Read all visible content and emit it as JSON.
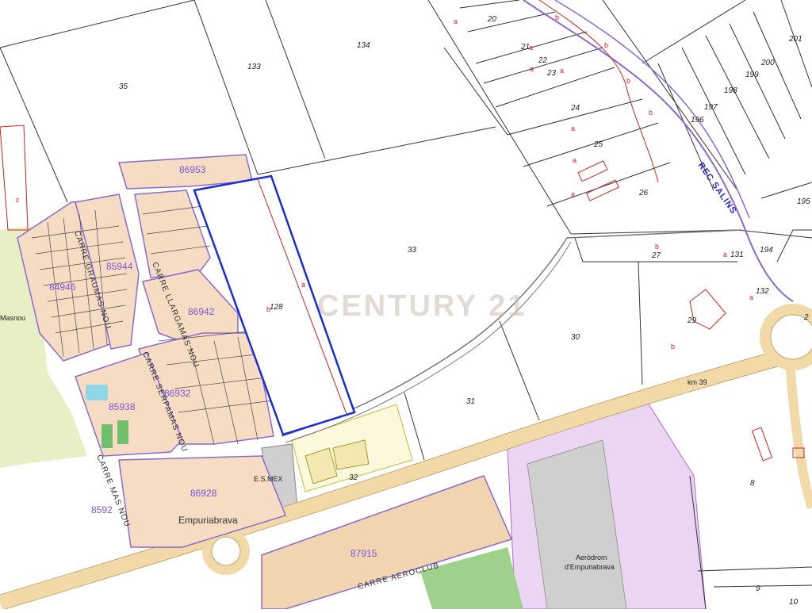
{
  "watermark": "CENTURY 21",
  "plots": {
    "p35": "35",
    "p133": "133",
    "p134": "134",
    "p128": "128",
    "p33": "33",
    "p20": "20",
    "p21": "21",
    "p22": "22",
    "p23": "23",
    "p24": "24",
    "p25": "25",
    "p26": "26",
    "p27": "27",
    "p29": "29",
    "p30": "30",
    "p31": "31",
    "p32": "32",
    "p8": "8",
    "p9": "9",
    "p10": "10",
    "p131": "131",
    "p132": "132",
    "p194": "194",
    "p195": "195",
    "p196": "196",
    "p197": "197",
    "p198": "198",
    "p199": "199",
    "p200": "200",
    "p201": "201",
    "p2": "2"
  },
  "registry": {
    "r86953": "86953",
    "r85944": "85944",
    "r84946": "84946",
    "r86942": "86942",
    "r86932": "86932",
    "r85938": "85938",
    "r86928": "86928",
    "r8592": "8592",
    "r87915": "87915"
  },
  "streets": {
    "carre_graumas_nou": "CARRE GRAUMAS NOU",
    "carre_llargamas_nou": "CARRE LLARGAMAS NOU",
    "carre_serpamas_nou": "CARRE SERPAMAS NOU",
    "carre_mas_nou": "CARRE MAS NOU",
    "carre_aeroclub": "CARRE AEROCLUB",
    "rec_salins": "REC SALINS"
  },
  "places": {
    "empuriabrava": "Empuriabrava",
    "masnou": "Masnou",
    "es_mex": "E.S.MEX",
    "aerodrom_1": "Aeròdrom",
    "aerodrom_2": "d'Empuriabrava",
    "km": "km 39"
  },
  "subparcels": {
    "a": "a",
    "b": "b",
    "c": "c"
  }
}
